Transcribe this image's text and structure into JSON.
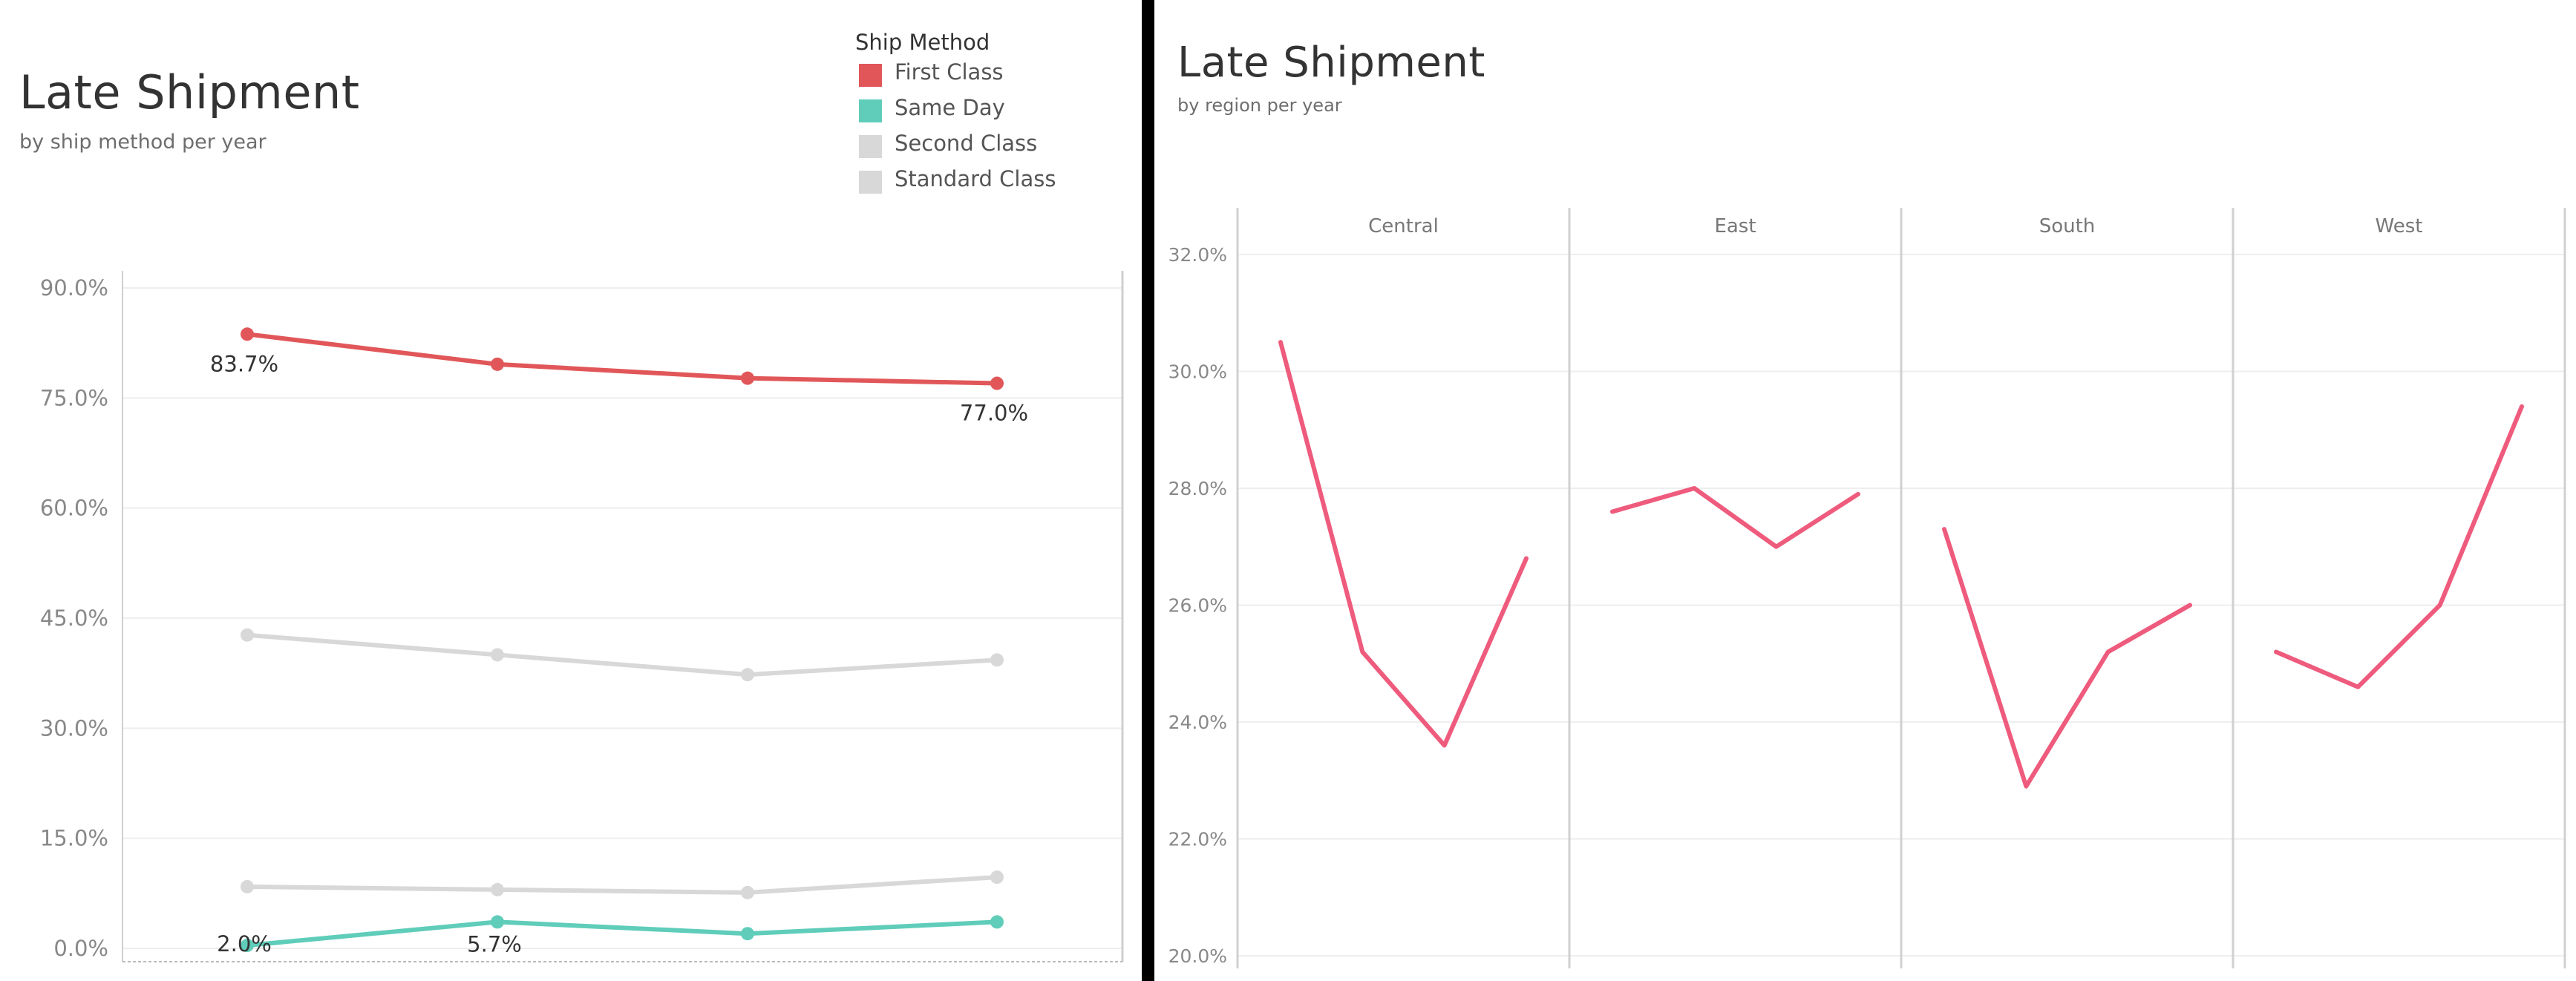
{
  "left": {
    "title": "Late Shipment",
    "subtitle": "by ship method per year",
    "legend": {
      "title": "Ship Method",
      "items": [
        {
          "label": "First Class",
          "color": "#e15759"
        },
        {
          "label": "Same Day",
          "color": "#5fcdb9"
        },
        {
          "label": "Second Class",
          "color": "#d8d8d8"
        },
        {
          "label": "Standard Class",
          "color": "#d8d8d8"
        }
      ]
    }
  },
  "right": {
    "title": "Late Shipment",
    "subtitle": "by region per year"
  },
  "chart_data": [
    {
      "type": "line",
      "title": "Late Shipment",
      "subtitle": "by ship method per year",
      "x": [
        1,
        2,
        3,
        4
      ],
      "ylim": [
        0,
        90
      ],
      "yticks": [
        "0.0%",
        "15.0%",
        "30.0%",
        "45.0%",
        "60.0%",
        "75.0%",
        "90.0%"
      ],
      "grid": true,
      "legend_position": "top-right",
      "series": [
        {
          "name": "First Class",
          "color": "#e15759",
          "values": [
            83.7,
            79.6,
            77.7,
            77.0
          ],
          "labels": [
            "83.7%",
            "",
            "",
            "77.0%"
          ]
        },
        {
          "name": "Second Class",
          "color": "#d8d8d8",
          "values": [
            42.7,
            40.0,
            37.3,
            39.3
          ],
          "labels": [
            "",
            "",
            "",
            ""
          ]
        },
        {
          "name": "Standard Class",
          "color": "#d8d8d8",
          "values": [
            8.4,
            8.0,
            7.6,
            9.7
          ],
          "labels": [
            "",
            "",
            "",
            ""
          ]
        },
        {
          "name": "Same Day",
          "color": "#5fcdb9",
          "values": [
            0.4,
            3.6,
            2.0,
            3.6
          ],
          "labels": [
            "2.0%",
            "5.7%",
            "",
            ""
          ]
        }
      ]
    },
    {
      "type": "line",
      "title": "Late Shipment",
      "subtitle": "by region per year",
      "facets": [
        "Central",
        "East",
        "South",
        "West"
      ],
      "ylim": [
        20,
        32
      ],
      "yticks": [
        "20.0%",
        "22.0%",
        "24.0%",
        "26.0%",
        "28.0%",
        "30.0%",
        "32.0%"
      ],
      "grid": true,
      "color": "#ee5b7d",
      "series": [
        {
          "name": "Central",
          "values": [
            30.5,
            25.2,
            23.6,
            26.8
          ]
        },
        {
          "name": "East",
          "values": [
            27.6,
            28.0,
            27.0,
            27.9
          ]
        },
        {
          "name": "South",
          "values": [
            27.3,
            22.9,
            25.2,
            26.0
          ]
        },
        {
          "name": "West",
          "values": [
            25.2,
            24.6,
            26.0,
            29.4
          ]
        }
      ]
    }
  ]
}
